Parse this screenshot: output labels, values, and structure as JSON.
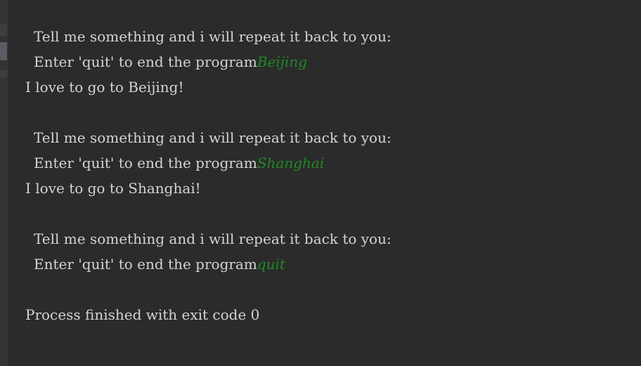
{
  "console": {
    "blocks": [
      {
        "prompt_line1": "Tell me something and i will repeat it back to you:",
        "prompt_line2": "Enter 'quit' to end the program",
        "input": "Beijing",
        "response": "I love to go to Beijing!"
      },
      {
        "prompt_line1": "Tell me something and i will repeat it back to you:",
        "prompt_line2": "Enter 'quit' to end the program",
        "input": "Shanghai",
        "response": "I love to go to Shanghai!"
      },
      {
        "prompt_line1": "Tell me something and i will repeat it back to you:",
        "prompt_line2": "Enter 'quit' to end the program",
        "input": "quit"
      }
    ],
    "exit_message": "Process finished with exit code 0"
  },
  "colors": {
    "background": "#2b2b2b",
    "text": "#d4d4d4",
    "user_input": "#1f8a25"
  }
}
